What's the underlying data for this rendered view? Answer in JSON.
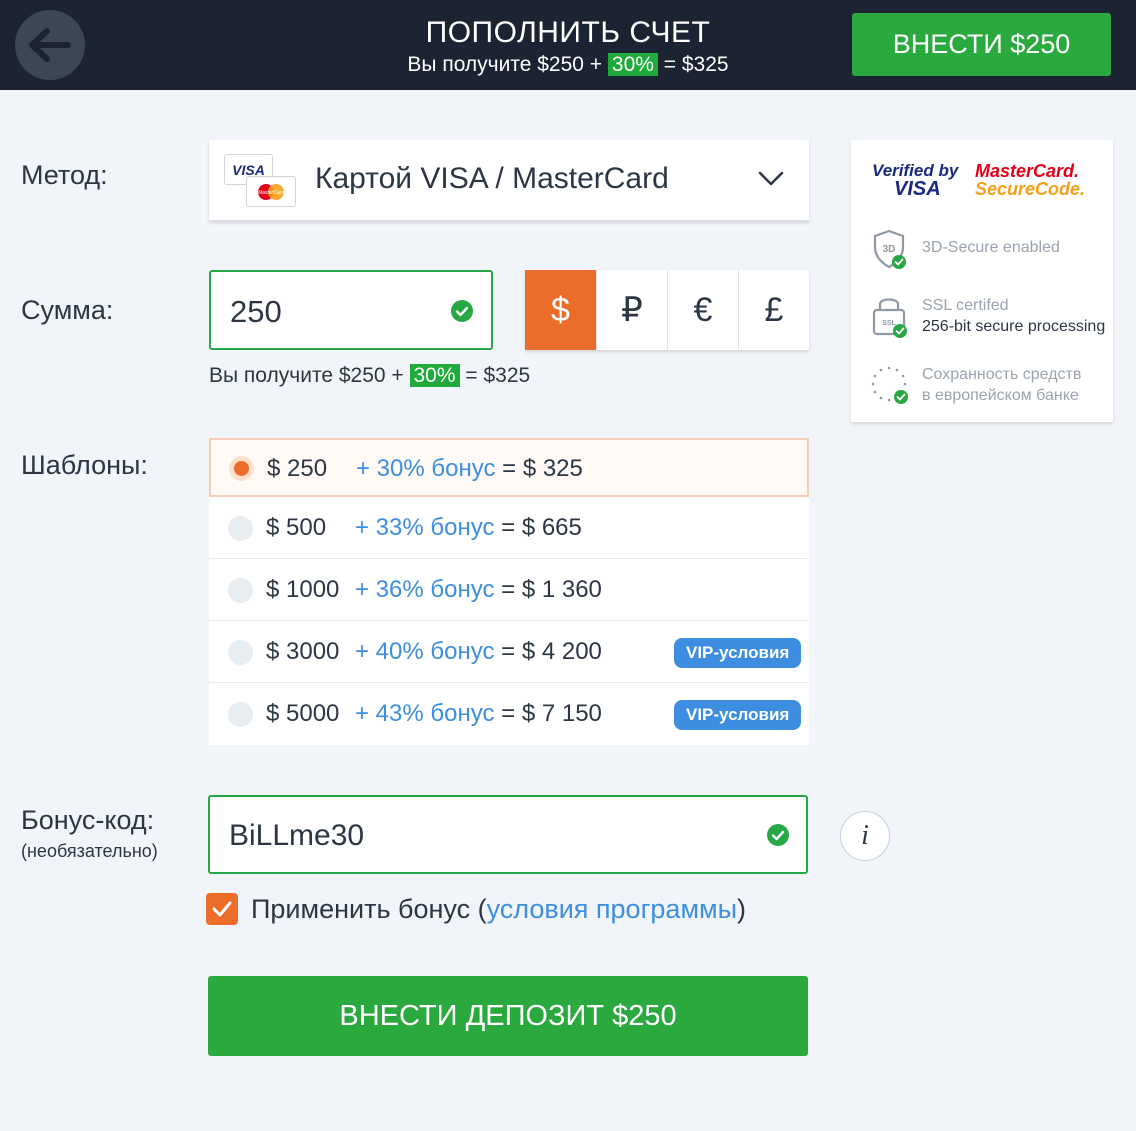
{
  "header": {
    "title": "ПОПОЛНИТЬ СЧЕТ",
    "subtitle_prefix": "Вы получите  $250 + ",
    "subtitle_pct": "30%",
    "subtitle_suffix": " = $325",
    "cta_label": "ВНЕСТИ $250"
  },
  "method": {
    "label": "Метод:",
    "visa_logo_text": "VISA",
    "mastercard_logo_text": "MasterCard",
    "selected": "Картой VISA / MasterCard"
  },
  "amount": {
    "label": "Сумма:",
    "value": "250",
    "currencies": [
      "$",
      "₽",
      "€",
      "£"
    ],
    "selected_currency": "$",
    "note_prefix": "Вы получите  $250 + ",
    "note_pct": "30%",
    "note_suffix": " = $325"
  },
  "templates": {
    "label": "Шаблоны:",
    "items": [
      {
        "amount": "$ 250",
        "bonus": "+ 30% бонус",
        "total": " = $ 325",
        "selected": true,
        "vip": ""
      },
      {
        "amount": "$ 500",
        "bonus": "+ 33% бонус",
        "total": " = $ 665",
        "selected": false,
        "vip": ""
      },
      {
        "amount": "$ 1000",
        "bonus": "+ 36% бонус",
        "total": " = $ 1 360",
        "selected": false,
        "vip": ""
      },
      {
        "amount": "$ 3000",
        "bonus": "+ 40% бонус",
        "total": " = $ 4 200",
        "selected": false,
        "vip": "VIP-условия"
      },
      {
        "amount": "$ 5000",
        "bonus": "+ 43% бонус",
        "total": " = $ 7 150",
        "selected": false,
        "vip": "VIP-условия"
      }
    ]
  },
  "bonus": {
    "label": "Бонус-код:",
    "sublabel": "(необязательно)",
    "code": "BiLLme30",
    "info_glyph": "i",
    "apply_prefix": "Применить бонус (",
    "apply_link": "условия программы",
    "apply_suffix": ")",
    "apply_checked": true
  },
  "submit": {
    "label": "ВНЕСТИ ДЕПОЗИТ $250"
  },
  "security": {
    "verified_line1": "Verified by",
    "verified_line2": "VISA",
    "mc_line1": "MasterCard.",
    "mc_line2": "SecureCode.",
    "item1": "3D-Secure enabled",
    "item1_icon_text": "3D",
    "item2_line1": "SSL certifed",
    "item2_line2": "256-bit secure processing",
    "item2_icon_text": "SSL",
    "item3_line1": "Сохранность средств",
    "item3_line2": "в европейском банке"
  },
  "colors": {
    "header_bg": "#1c2433",
    "accent_green": "#2aaa3e",
    "accent_orange": "#ec6d2a",
    "link_blue": "#3d8ee0"
  },
  "icons": [
    "back-arrow-icon",
    "chevron-down-icon",
    "check-circle-icon",
    "checkmark-icon",
    "info-icon",
    "shield-3d-icon",
    "lock-ssl-icon",
    "eu-stars-icon"
  ]
}
